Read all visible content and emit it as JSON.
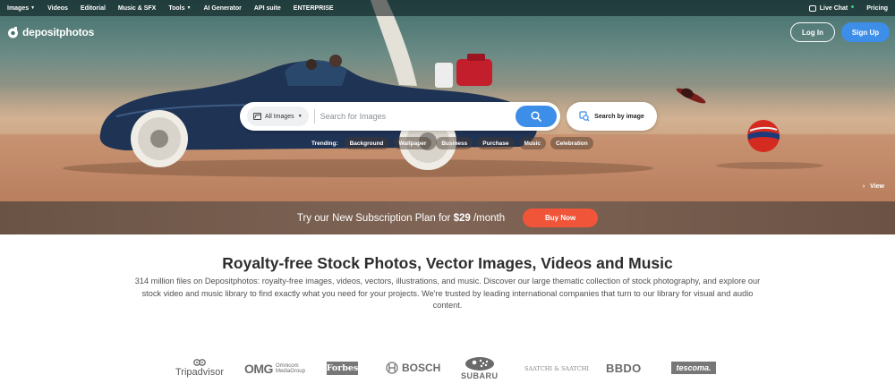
{
  "topnav": {
    "items": [
      "Images",
      "Videos",
      "Editorial",
      "Music & SFX",
      "Tools",
      "AI Generator",
      "API suite",
      "ENTERPRISE"
    ],
    "live_chat": "Live Chat",
    "pricing": "Pricing"
  },
  "logo": {
    "text": "depositphotos"
  },
  "auth": {
    "login": "Log In",
    "signup": "Sign Up"
  },
  "search": {
    "category": "All Images",
    "placeholder": "Search for Images",
    "search_by_image": "Search by image"
  },
  "trending": {
    "label": "Trending:",
    "tags": [
      "Background",
      "Wallpaper",
      "Business",
      "Purchase",
      "Music",
      "Celebration"
    ]
  },
  "view_link": "View",
  "promo": {
    "text_before": "Try our New Subscription Plan for ",
    "price": "$29",
    "text_after": " /month",
    "button": "Buy Now"
  },
  "headline": "Royalty-free Stock Photos, Vector Images, Videos and Music",
  "description": "314 million files on Depositphotos: royalty-free images, videos, vectors, illustrations, and music. Discover our large thematic collection of stock photography, and explore our stock video and music library to find exactly what you need for your projects. We're trusted by leading international companies that turn to our library for visual and audio content.",
  "brands": {
    "tripadvisor": "Tripadvisor",
    "omg": "OMG",
    "omnicom_1": "Omnicom",
    "omnicom_2": "MediaGroup",
    "forbes": "Forbes",
    "bosch": "BOSCH",
    "subaru": "SUBARU",
    "saatchi": "SAATCHI & SAATCHI",
    "bbdo": "BBDO",
    "tescoma": "tescoma."
  },
  "colors": {
    "primary": "#3d8ee8",
    "accent": "#f0553a",
    "promo_bg": "#7a5f50"
  }
}
